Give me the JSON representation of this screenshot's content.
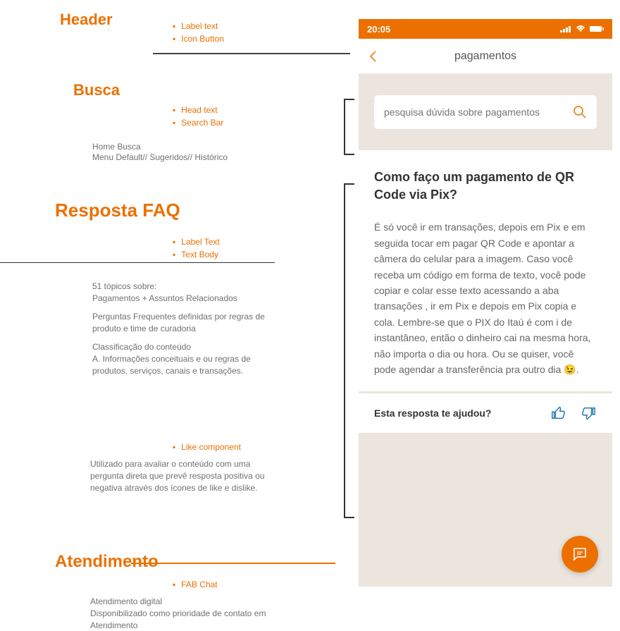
{
  "annotations": {
    "sections": {
      "header": "Header",
      "busca": "Busca",
      "resposta": "Resposta FAQ",
      "atendimento": "Atendimento"
    },
    "bullets": {
      "label_text": "Label text",
      "icon_button": "Icon Button",
      "head_text": "Head text",
      "search_bar": "Search Bar",
      "label_text2": "Label Text",
      "text_body": "Text Body",
      "like_component": "Like component",
      "fab_chat": "FAB Chat"
    },
    "notes": {
      "home_busca": "Home Busca",
      "menu_default": "Menu Default// Sugeridos// Histórico",
      "topicos": "51 tópicos sobre:\nPagamentos + Assuntos Relacionados",
      "perguntas": "Perguntas Frequentes definidas por regras de produto e time de curadoria",
      "classificacao": "Classificação do conteúdo\nA. Informações conceituais e ou regras de produtos, serviços, canais e transações.",
      "like_desc": "Utilizado para avaliar o conteúdo com uma pergunta direta que prevê resposta positiva ou negativa através dos ícones de like e dislike.",
      "atendimento_desc": "Atendimento digital\nDisponibilizado como prioridade de contato em Atendimento"
    }
  },
  "phone": {
    "status": {
      "time": "20:05"
    },
    "nav": {
      "title": "pagamentos"
    },
    "search": {
      "placeholder": "pesquisa dúvida sobre pagamentos"
    },
    "faq": {
      "title": "Como faço um pagamento de QR Code via Pix?",
      "body": "É só você ir em transações, depois em Pix e em seguida tocar em pagar QR Code e apontar a câmera do celular para a imagem. Caso você receba um código em forma de texto, você pode copiar e colar esse texto acessando a aba transações , ir em Pix e depois em Pix copia e cola. Lembre-se que o PIX do Itaú é com i de instantâneo, então o dinheiro cai na mesma hora, não importa o dia ou hora. Ou se quiser, você pode agendar a transferência pra outro dia 😉."
    },
    "feedback": {
      "question": "Esta resposta te ajudou?"
    }
  }
}
